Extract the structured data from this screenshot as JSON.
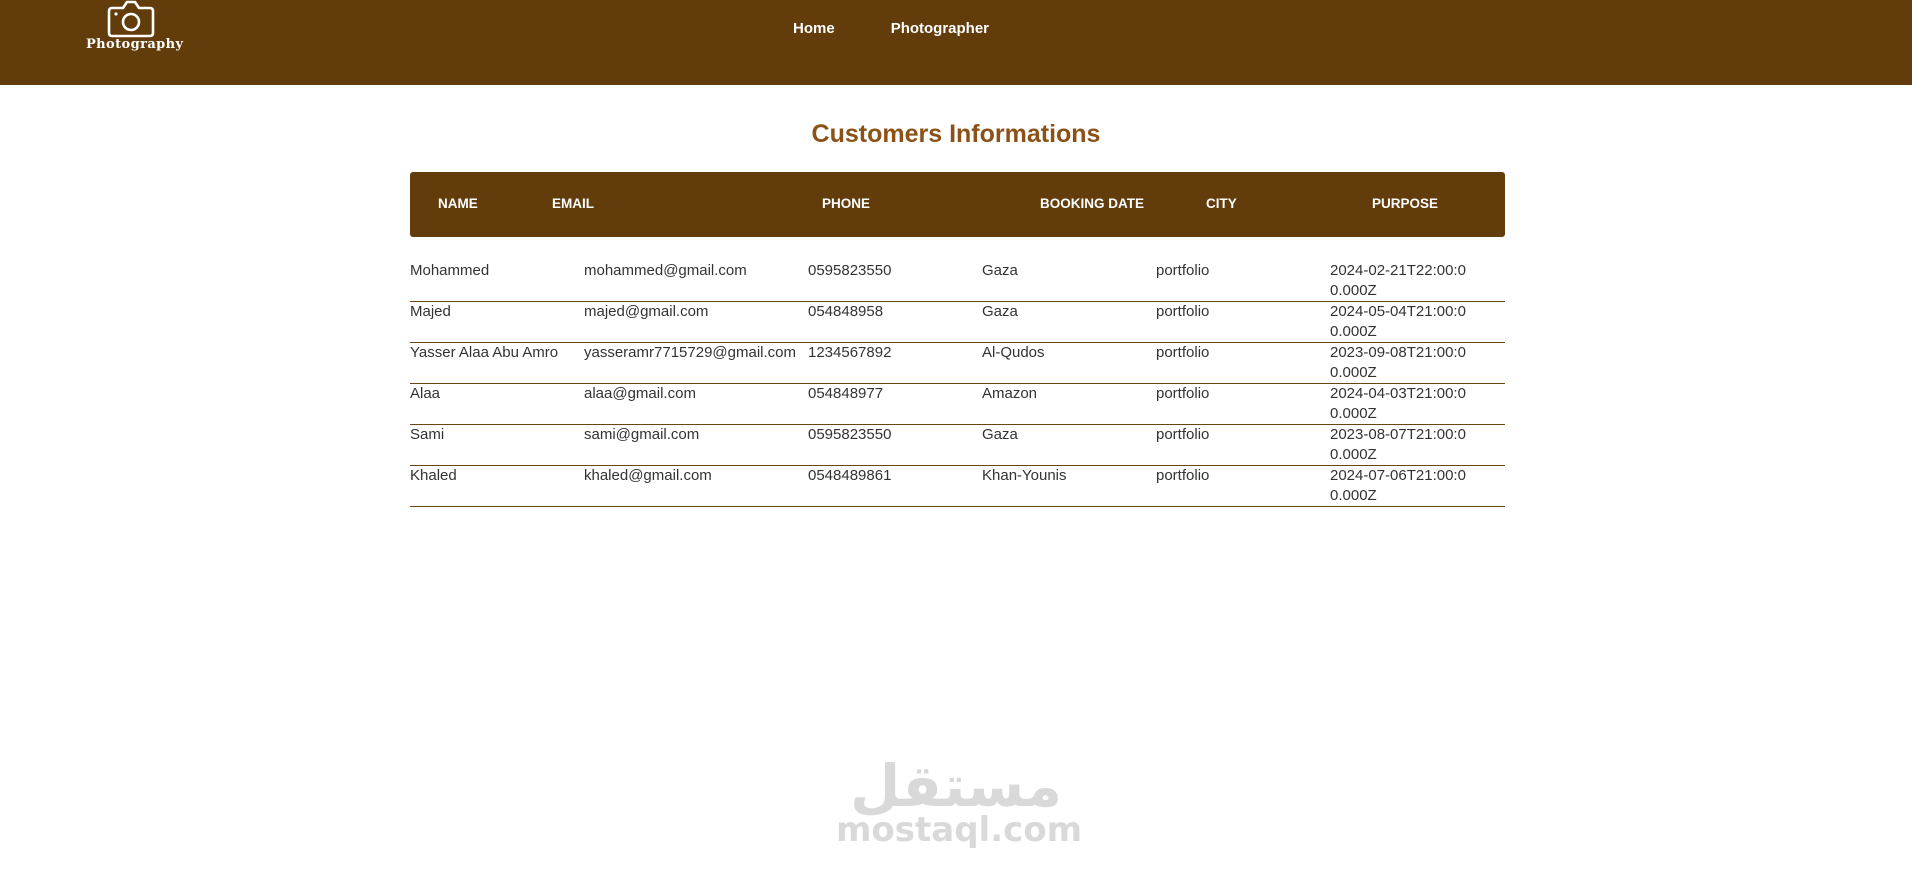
{
  "header": {
    "logo_text": "Photography",
    "nav": [
      {
        "label": "Home"
      },
      {
        "label": "Photographer"
      }
    ]
  },
  "main": {
    "title": "Customers Informations",
    "columns": [
      "NAME",
      "EMAIL",
      "PHONE",
      "BOOKING DATE",
      "CITY",
      "PURPOSE"
    ],
    "rows": [
      [
        "Mohammed",
        "mohammed@gmail.com",
        "0595823550",
        "Gaza",
        "portfolio",
        "2024-02-21T22:00:00.000Z"
      ],
      [
        "Majed",
        "majed@gmail.com",
        "054848958",
        "Gaza",
        "portfolio",
        "2024-05-04T21:00:00.000Z"
      ],
      [
        "Yasser Alaa Abu Amro",
        "yasseramr7715729@gmail.com",
        "1234567892",
        "Al-Qudos",
        "portfolio",
        "2023-09-08T21:00:00.000Z"
      ],
      [
        "Alaa",
        "alaa@gmail.com",
        "054848977",
        "Amazon",
        "portfolio",
        "2024-04-03T21:00:00.000Z"
      ],
      [
        "Sami",
        "sami@gmail.com",
        "0595823550",
        "Gaza",
        "portfolio",
        "2023-08-07T21:00:00.000Z"
      ],
      [
        "Khaled",
        "khaled@gmail.com",
        "0548489861",
        "Khan-Younis",
        "portfolio",
        "2024-07-06T21:00:00.000Z"
      ]
    ]
  },
  "watermark": {
    "arabic": "مستقل",
    "latin": "mostaql.com"
  },
  "colors": {
    "brand": "#623c0b",
    "title": "#8b5218"
  },
  "icons": {
    "logo": "camera-icon"
  }
}
